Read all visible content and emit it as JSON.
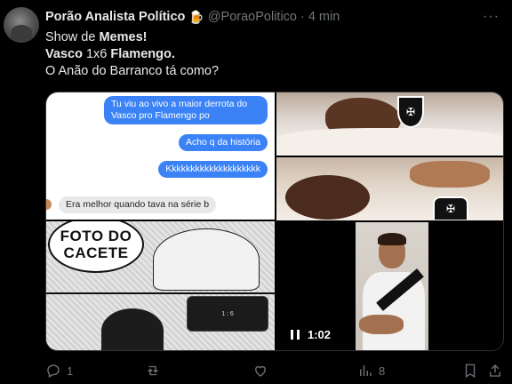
{
  "author": {
    "name": "Porão Analista Político",
    "badge_emoji": "🍺",
    "handle": "@PoraoPolitico",
    "separator": "·",
    "time": "4 min"
  },
  "more_label": "···",
  "body": {
    "line1_pre": "Show de ",
    "line1_bold": "Memes!",
    "line2_bold1": "Vasco",
    "line2_mid": " 1x6 ",
    "line2_bold2": "Flamengo.",
    "line3": "O Anão do Barranco tá como?"
  },
  "chat": {
    "msg1": "Tu viu ao vivo a maior derrota do Vasco pro Flamengo po",
    "msg2": "Acho q da história",
    "msg3": "Kkkkkkkkkkkkkkkkkkkk",
    "reply": "Era melhor quando tava na série b"
  },
  "manga": {
    "speech_line1": "FOTO DO",
    "speech_line2": "CACETE"
  },
  "video": {
    "duration": "1:02"
  },
  "actions": {
    "replies": "1",
    "reposts": "",
    "likes": "",
    "views": "8"
  },
  "colors": {
    "background": "#000000",
    "text": "#e7e9ea",
    "muted": "#71767b",
    "bubble_blue": "#3b82f6"
  }
}
